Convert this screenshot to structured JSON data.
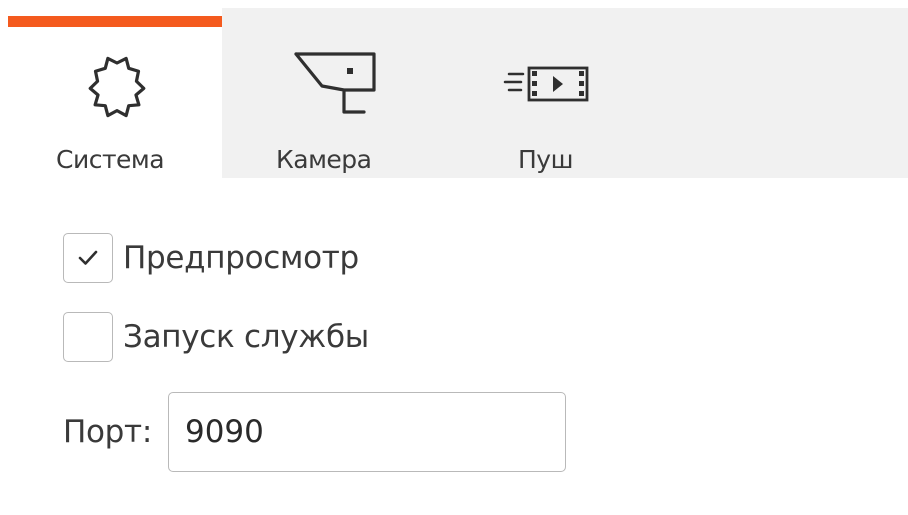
{
  "tabs": [
    {
      "id": "system",
      "label": "Система",
      "icon": "gear-icon",
      "active": true
    },
    {
      "id": "camera",
      "label": "Камера",
      "icon": "security-camera-icon",
      "active": false
    },
    {
      "id": "push",
      "label": "Пуш",
      "icon": "video-push-icon",
      "active": false
    }
  ],
  "settings": {
    "preview": {
      "label": "Предпросмотр",
      "checked": true
    },
    "service": {
      "label": "Запуск службы",
      "checked": false
    },
    "port": {
      "label": "Порт:",
      "value": "9090"
    }
  },
  "colors": {
    "accent": "#f45a1e",
    "tabbar_bg": "#f1f1f1",
    "border": "#b9b9b9",
    "text": "#3a3a3a"
  }
}
